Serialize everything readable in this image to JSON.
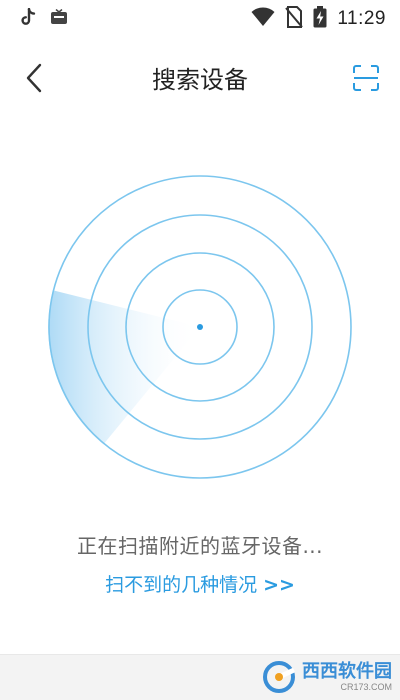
{
  "status_bar": {
    "time": "11:29",
    "left_icons": [
      "tiktok-icon",
      "tv-app-icon"
    ],
    "right_icons": [
      "wifi-icon",
      "no-sim-icon",
      "battery-charging-icon"
    ]
  },
  "header": {
    "title": "搜索设备",
    "back_icon": "back-chevron-icon",
    "scan_icon": "scan-icon"
  },
  "radar": {
    "rings": 4,
    "accent_color": "#7cc6ee",
    "sweep_color": "#bfe3f8",
    "center_color": "#2a9be0"
  },
  "scan_status": "正在扫描附近的蓝牙设备...",
  "help_link": {
    "label": "扫不到的几种情况",
    "arrows": ">>"
  },
  "watermark": {
    "brand": "西西软件园",
    "url": "CR173.COM"
  }
}
